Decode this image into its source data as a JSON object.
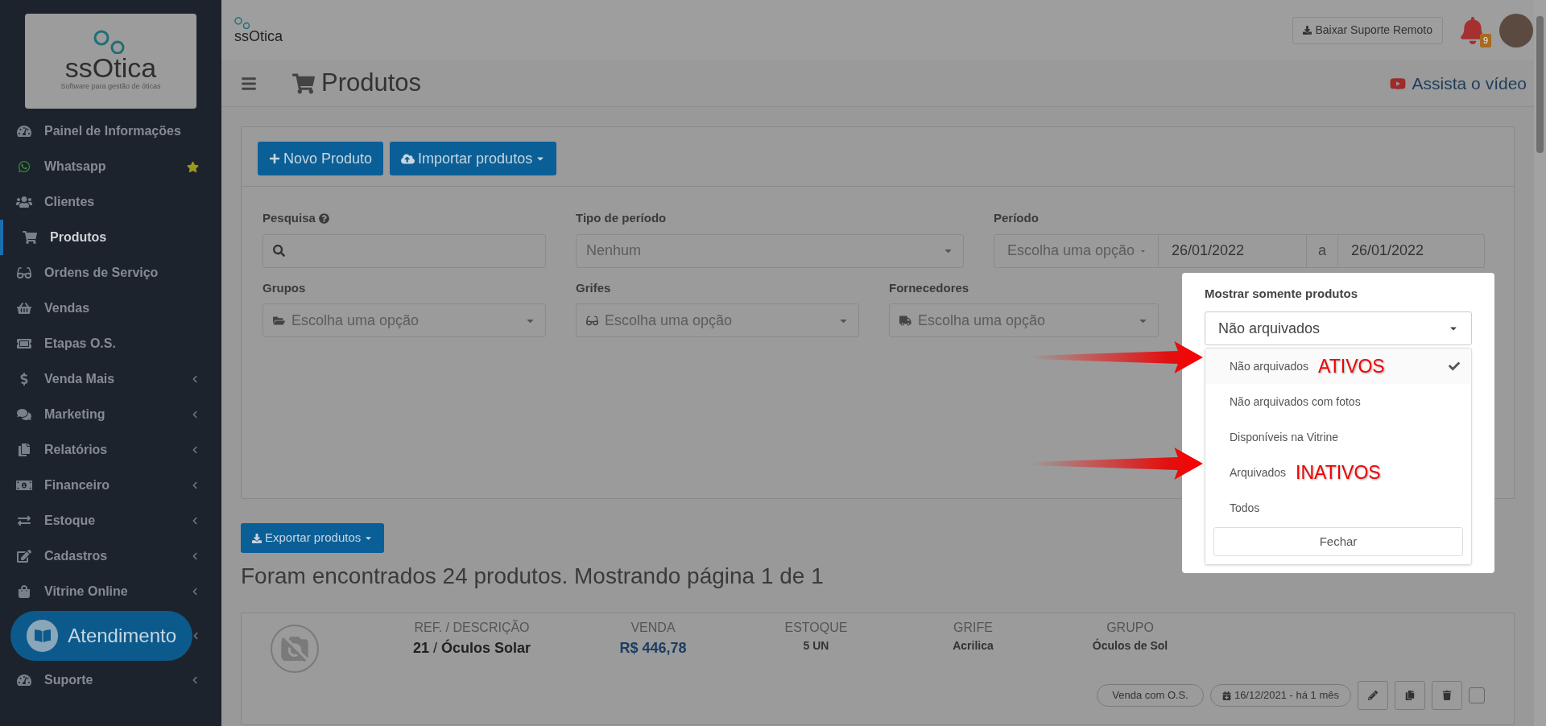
{
  "sidebar": {
    "logo": {
      "name": "ssOtica",
      "tagline": "Software para gestão de óticas"
    },
    "items": [
      {
        "label": "Painel de Informações",
        "selected": false,
        "submenu": false,
        "starred": false
      },
      {
        "label": "Whatsapp",
        "selected": false,
        "submenu": false,
        "starred": true
      },
      {
        "label": "Clientes",
        "selected": false,
        "submenu": false,
        "starred": false
      },
      {
        "label": "Produtos",
        "selected": true,
        "submenu": false,
        "starred": false
      },
      {
        "label": "Ordens de Serviço",
        "selected": false,
        "submenu": false,
        "starred": false
      },
      {
        "label": "Vendas",
        "selected": false,
        "submenu": false,
        "starred": false
      },
      {
        "label": "Etapas O.S.",
        "selected": false,
        "submenu": false,
        "starred": false
      },
      {
        "label": "Venda Mais",
        "selected": false,
        "submenu": true,
        "starred": false
      },
      {
        "label": "Marketing",
        "selected": false,
        "submenu": true,
        "starred": false
      },
      {
        "label": "Relatórios",
        "selected": false,
        "submenu": true,
        "starred": false
      },
      {
        "label": "Financeiro",
        "selected": false,
        "submenu": true,
        "starred": false
      },
      {
        "label": "Estoque",
        "selected": false,
        "submenu": true,
        "starred": false
      },
      {
        "label": "Cadastros",
        "selected": false,
        "submenu": true,
        "starred": false
      },
      {
        "label": "Vitrine Online",
        "selected": false,
        "submenu": true,
        "starred": false
      },
      {
        "submenu": true
      },
      {
        "label": "Suporte",
        "selected": false,
        "submenu": true,
        "starred": false
      }
    ],
    "chat_button": "Atendimento"
  },
  "topbar": {
    "logo": "ssOtica",
    "remote_button": "Baixar Suporte Remoto",
    "notifications": "9"
  },
  "page_header": {
    "title": "Produtos",
    "video_link": "Assista o vídeo"
  },
  "actions": [
    {
      "label": "Novo Produto",
      "kind": "plus"
    },
    {
      "label": "Importar produtos",
      "kind": "upload"
    }
  ],
  "filters": {
    "search": {
      "label": "Pesquisa"
    },
    "period_type": {
      "label": "Tipo de período",
      "value": "Nenhum"
    },
    "period": {
      "label": "Período",
      "preset": "Escolha uma opção",
      "from": "26/01/2022",
      "separator": "a",
      "to": "26/01/2022"
    },
    "groups": {
      "label": "Grupos",
      "placeholder": "Escolha uma opção"
    },
    "brands": {
      "label": "Grifes",
      "placeholder": "Escolha uma opção"
    },
    "suppliers": {
      "label": "Fornecedores",
      "placeholder": "Escolha uma opção"
    },
    "show_only": {
      "label": "Mostrar somente produtos",
      "value": "Não arquivados",
      "expanded": true,
      "options": [
        {
          "label": "Não arquivados",
          "selected": true,
          "annotation": "ATIVOS"
        },
        {
          "label": "Não arquivados com fotos",
          "selected": false
        },
        {
          "label": "Disponíveis na Vitrine",
          "selected": false
        },
        {
          "label": "Arquivados",
          "selected": false,
          "annotation": "INATIVOS"
        },
        {
          "label": "Todos",
          "selected": false
        }
      ],
      "close_button": "Fechar"
    }
  },
  "export_button": "Exportar produtos",
  "results_summary": "Foram encontrados 24 produtos. Mostrando página 1 de 1",
  "products": [
    {
      "columns": [
        {
          "header": "REF. / DESCRIÇÃO",
          "value": "**21** / **Óculos Solar**",
          "kind": "title"
        },
        {
          "header": "VENDA",
          "value": "R$ 446,78",
          "kind": "price"
        },
        {
          "header": "ESTOQUE",
          "value": "**5** UN",
          "kind": "small"
        },
        {
          "header": "GRIFE",
          "value": "Acrilica",
          "kind": "small"
        },
        {
          "header": "GRUPO",
          "value": "Óculos de Sol",
          "kind": "small"
        }
      ],
      "tag": "Venda com O.S.",
      "date": "16/12/2021 - há 1 mês",
      "checked": false
    }
  ]
}
